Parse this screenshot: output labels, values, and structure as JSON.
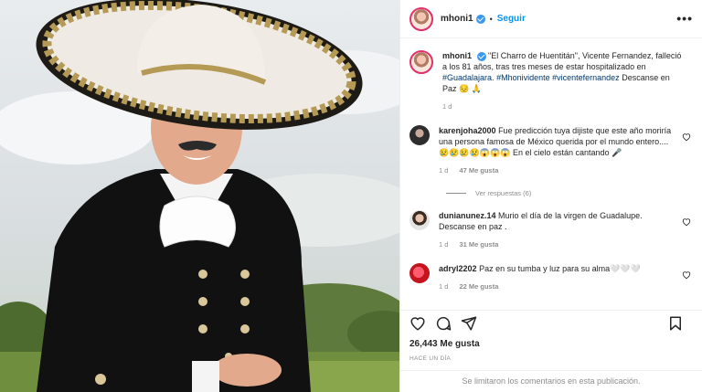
{
  "header": {
    "username": "mhoni1",
    "separator": "•",
    "follow_label": "Seguir",
    "more_label": "•••"
  },
  "caption": {
    "username": "mhoni1",
    "text": "\"El Charro de Huentitán\", Vicente Fernandez, falleció a los 81 años, tras tres meses de estar hospitalizado en ",
    "tag1": "#Guadalajara",
    "tag2": "#Mhonividente",
    "tag3": "#vicentefernandez",
    "tail": " Descanse en Paz 😔 🙏",
    "time": "1 d"
  },
  "comments": [
    {
      "username": "karenjoha2000",
      "text": "Fue predicción tuya dijiste que este año moriría una persona famosa de México querida por el mundo entero.... 😢😢😢😢😱😱😱 En el cielo están cantando 🎤",
      "time": "1 d",
      "likes": "47 Me gusta",
      "replies": "Ver respuestas (6)"
    },
    {
      "username": "dunianunez.14",
      "text": "Murio el día de la virgen de Guadalupe. Descanse en paz .",
      "time": "1 d",
      "likes": "31 Me gusta"
    },
    {
      "username": "adryl2202",
      "text": "Paz en su tumba y luz para su alma🤍🤍🤍",
      "time": "1 d",
      "likes": "22 Me gusta"
    }
  ],
  "likes_count": "26,443",
  "likes_label": "Me gusta",
  "post_date": "HACE UN DÍA",
  "comments_limited": "Se limitaron los comentarios en esta publicación.",
  "icons": [
    "heart-icon",
    "comment-icon",
    "share-icon",
    "bookmark-icon",
    "verified-badge-icon",
    "more-options-icon"
  ],
  "colors": {
    "accent": "#0095f6",
    "verified": "#3897f0",
    "hashtag": "#00376b",
    "muted": "#8e8e8e"
  }
}
